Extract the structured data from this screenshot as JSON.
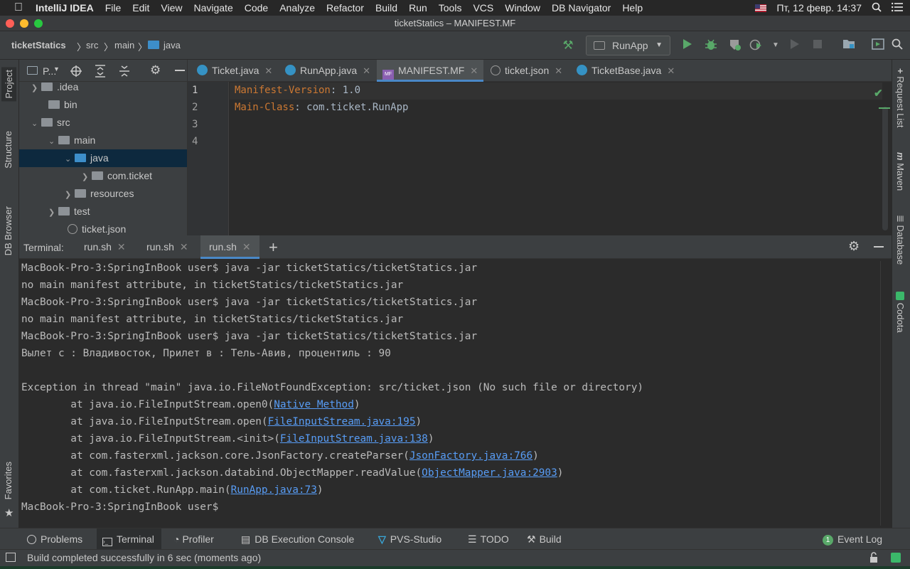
{
  "menubar": {
    "app": "IntelliJ IDEA",
    "items": [
      "File",
      "Edit",
      "View",
      "Navigate",
      "Code",
      "Analyze",
      "Refactor",
      "Build",
      "Run",
      "Tools",
      "VCS",
      "Window",
      "DB Navigator",
      "Help"
    ],
    "datetime": "Пт, 12 февр.  14:37"
  },
  "window": {
    "title": "ticketStatics – MANIFEST.MF"
  },
  "navbar": {
    "breadcrumbs": [
      "ticketStatics",
      "src",
      "main",
      "java"
    ],
    "run_config": "RunApp"
  },
  "left_strip": {
    "project": "Project",
    "structure": "Structure",
    "db_browser": "DB Browser",
    "favorites": "Favorites"
  },
  "right_strip": {
    "request_list": "Request List",
    "maven": "Maven",
    "database": "Database",
    "codota": "Codota"
  },
  "project_panel": {
    "title": "P...",
    "tree": [
      {
        "label": ".idea",
        "type": "folder"
      },
      {
        "label": "bin",
        "type": "folder"
      },
      {
        "label": "src",
        "type": "folder"
      },
      {
        "label": "main",
        "type": "folder"
      },
      {
        "label": "java",
        "type": "source-folder"
      },
      {
        "label": "com.ticket",
        "type": "package"
      },
      {
        "label": "resources",
        "type": "folder"
      },
      {
        "label": "test",
        "type": "folder"
      },
      {
        "label": "ticket.json",
        "type": "file"
      }
    ]
  },
  "editor": {
    "tabs": [
      {
        "label": "Ticket.java"
      },
      {
        "label": "RunApp.java"
      },
      {
        "label": "MANIFEST.MF",
        "active": true
      },
      {
        "label": "ticket.json"
      },
      {
        "label": "TicketBase.java"
      }
    ],
    "line_numbers": [
      "1",
      "2",
      "3",
      "4"
    ],
    "lines": [
      {
        "key": "Manifest-Version",
        "value": ": 1.0"
      },
      {
        "key": "Main-Class",
        "value": ": com.ticket.RunApp"
      }
    ]
  },
  "terminal": {
    "label": "Terminal:",
    "tabs": [
      "run.sh",
      "run.sh",
      "run.sh"
    ],
    "lines": [
      "MacBook-Pro-3:SpringInBook user$ java -jar ticketStatics/ticketStatics.jar",
      "no main manifest attribute, in ticketStatics/ticketStatics.jar",
      "MacBook-Pro-3:SpringInBook user$ java -jar ticketStatics/ticketStatics.jar",
      "no main manifest attribute, in ticketStatics/ticketStatics.jar",
      "MacBook-Pro-3:SpringInBook user$ java -jar ticketStatics/ticketStatics.jar",
      "Вылет с : Владивосток, Прилет в : Тель-Авив, процентиль : 90",
      "",
      "Exception in thread \"main\" java.io.FileNotFoundException: src/ticket.json (No such file or directory)"
    ],
    "stack": [
      {
        "prefix": "        at java.io.FileInputStream.open0(",
        "link": "Native Method",
        "suffix": ")"
      },
      {
        "prefix": "        at java.io.FileInputStream.open(",
        "link": "FileInputStream.java:195",
        "suffix": ")"
      },
      {
        "prefix": "        at java.io.FileInputStream.<init>(",
        "link": "FileInputStream.java:138",
        "suffix": ")"
      },
      {
        "prefix": "        at com.fasterxml.jackson.core.JsonFactory.createParser(",
        "link": "JsonFactory.java:766",
        "suffix": ")"
      },
      {
        "prefix": "        at com.fasterxml.jackson.databind.ObjectMapper.readValue(",
        "link": "ObjectMapper.java:2903",
        "suffix": ")"
      },
      {
        "prefix": "        at com.ticket.RunApp.main(",
        "link": "RunApp.java:73",
        "suffix": ")"
      }
    ],
    "prompt": "MacBook-Pro-3:SpringInBook user$"
  },
  "bottom_tools": {
    "problems": "Problems",
    "terminal": "Terminal",
    "profiler": "Profiler",
    "db_console": "DB Execution Console",
    "pvs": "PVS-Studio",
    "todo": "TODO",
    "build": "Build",
    "event_log": "Event Log",
    "event_count": "1"
  },
  "status": {
    "text": "Build completed successfully in 6 sec (moments ago)"
  },
  "colors": {
    "accent": "#4a88c7",
    "keyword": "#cc7832",
    "link": "#589df6",
    "run_green": "#59a869"
  }
}
